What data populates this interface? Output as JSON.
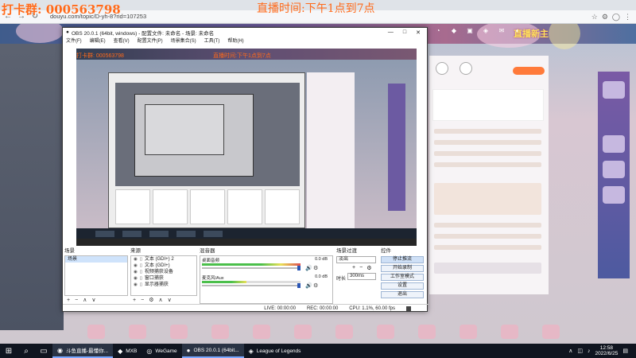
{
  "browser": {
    "url": "douyu.com/topic/D-yh-8?rid=107253",
    "nav": {
      "back": "←",
      "forward": "→",
      "reload": "↻"
    }
  },
  "overlays": {
    "top_left": "打卡群: 000563798",
    "top_center": "直播时间:下午1点到7点"
  },
  "site": {
    "banner_title": "直播新主"
  },
  "obs": {
    "title": "OBS 20.0.1 (64bit, windows) - 配置文件: 未命名 - 场景: 未命名",
    "window_controls": [
      "—",
      "□",
      "✕"
    ],
    "menu": [
      "文件(F)",
      "编辑(E)",
      "查看(V)",
      "配置文件(P)",
      "场景集合(S)",
      "工具(T)",
      "帮助(H)"
    ],
    "preview_overlay_left": "打卡群: 000563798",
    "preview_overlay_center": "直播时间:下午1点到7点",
    "docks": {
      "scenes": {
        "title": "场景",
        "items": [
          "场景"
        ],
        "footer": [
          "+",
          "−",
          "∧",
          "∨"
        ]
      },
      "sources": {
        "title": "来源",
        "items": [
          {
            "name": "文本 (GDI+) 2"
          },
          {
            "name": "文本 (GDI+)"
          },
          {
            "name": "视频捕获设备"
          },
          {
            "name": "窗口捕获"
          },
          {
            "name": "显示器捕获"
          }
        ],
        "footer": [
          "+",
          "−",
          "⚙",
          "∧",
          "∨"
        ]
      },
      "mixer": {
        "title": "混音器",
        "channels": [
          {
            "name": "麦克风/Aux",
            "db": "0.0 dB",
            "level": 0.0
          },
          {
            "name": "桌面音频",
            "db": "0.0 dB",
            "level": 0.0
          }
        ]
      },
      "transitions": {
        "title": "场景过渡",
        "selected": "淡出",
        "duration_label": "时长",
        "duration": "300ms",
        "footer": [
          "+",
          "−",
          "⚙"
        ]
      },
      "controls": {
        "title": "控件",
        "buttons": [
          "停止推流",
          "开始录制",
          "工作室模式",
          "设置",
          "退出"
        ]
      }
    },
    "status": {
      "live": "LIVE: 00:00:00",
      "rec": "REC: 00:00:00",
      "cpu": "CPU: 1.1%, 60.00 fps"
    }
  },
  "taskbar": {
    "start": "⊞",
    "apps": [
      {
        "icon": "◉",
        "label": "斗鱼直播-最懂你...",
        "active": true
      },
      {
        "icon": "◆",
        "label": "MXB",
        "active": false
      },
      {
        "icon": "◎",
        "label": "WeGame",
        "active": false
      },
      {
        "icon": "●",
        "label": "OBS 20.0.1 (64bit...",
        "active": true
      },
      {
        "icon": "◈",
        "label": "League of Legends",
        "active": false
      }
    ],
    "clock_time": "12:58",
    "clock_date": "2022/6/25"
  }
}
